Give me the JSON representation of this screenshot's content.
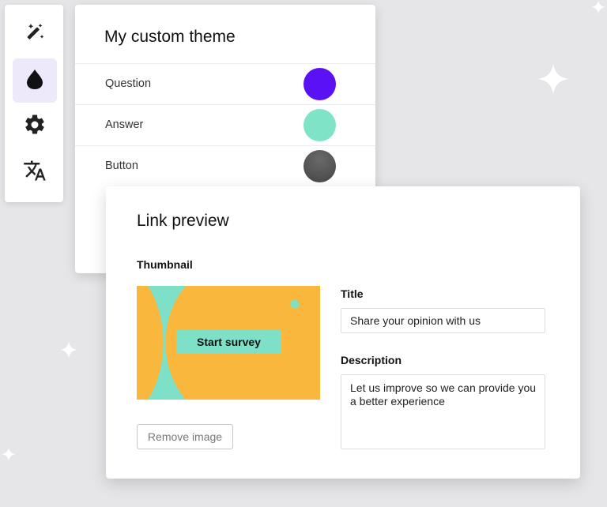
{
  "toolbar": {
    "items": [
      {
        "icon": "magic-wand-icon",
        "active": false
      },
      {
        "icon": "drop-icon",
        "active": true
      },
      {
        "icon": "gear-icon",
        "active": false
      },
      {
        "icon": "translate-icon",
        "active": false
      }
    ]
  },
  "theme": {
    "title": "My custom theme",
    "rows": [
      {
        "label": "Question",
        "color": "#5a12f5"
      },
      {
        "label": "Answer",
        "color": "#7fe3c8"
      },
      {
        "label": "Button",
        "color": "#555555"
      }
    ]
  },
  "preview": {
    "title": "Link preview",
    "thumbnail_label": "Thumbnail",
    "thumbnail_button": "Start survey",
    "remove_image_label": "Remove image",
    "title_label": "Title",
    "title_value": "Share your opinion with us",
    "description_label": "Description",
    "description_value": "Let us improve so we can provide you a better experience"
  },
  "colors": {
    "accent": "#5a12f5",
    "mint": "#7ee0c6",
    "orange": "#fab73d",
    "active_tool_bg": "#ede9fb"
  }
}
